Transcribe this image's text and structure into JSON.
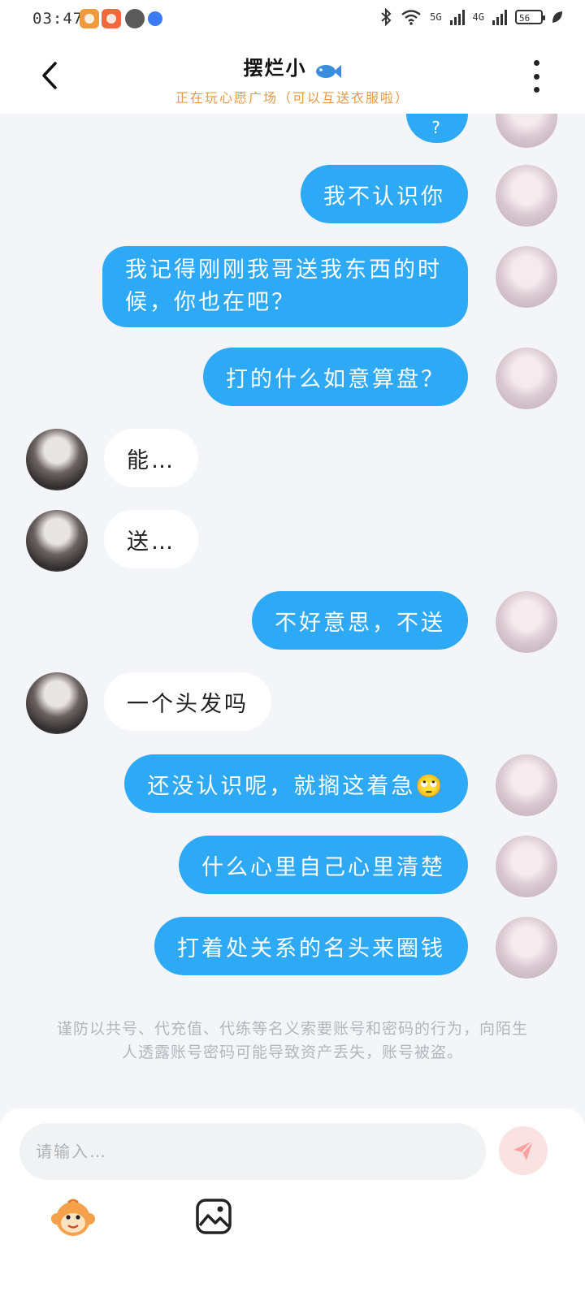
{
  "status_bar": {
    "time": "03:47",
    "network_1": "5G",
    "network_2": "4G",
    "battery": "56"
  },
  "header": {
    "title": "摆烂小",
    "subtitle": "正在玩心愿广场（可以互送衣服啦）"
  },
  "messages": [
    {
      "side": "out",
      "text": "?"
    },
    {
      "side": "out",
      "text": "我不认识你"
    },
    {
      "side": "out",
      "text": "我记得刚刚我哥送我东西的时候，你也在吧？"
    },
    {
      "side": "out",
      "text": "打的什么如意算盘？"
    },
    {
      "side": "in",
      "text": "能…"
    },
    {
      "side": "in",
      "text": "送…"
    },
    {
      "side": "out",
      "text": "不好意思，不送"
    },
    {
      "side": "in",
      "text": "一个头发吗"
    },
    {
      "side": "out",
      "text": "还没认识呢，就搁这着急🙄"
    },
    {
      "side": "out",
      "text": "什么心里自己心里清楚"
    },
    {
      "side": "out",
      "text": "打着处关系的名头来圈钱"
    }
  ],
  "warning": "谨防以共号、代充值、代练等名义索要账号和密码的行为，向陌生人透露账号密码可能导致资产丢失，账号被盗。",
  "input": {
    "placeholder": "请输入…"
  },
  "colors": {
    "outgoing_bubble": "#2ea9f5",
    "incoming_bubble": "#ffffff",
    "subtitle": "#e79a43",
    "send_button_bg": "#fbe2e2",
    "send_icon": "#f8a3a3"
  }
}
